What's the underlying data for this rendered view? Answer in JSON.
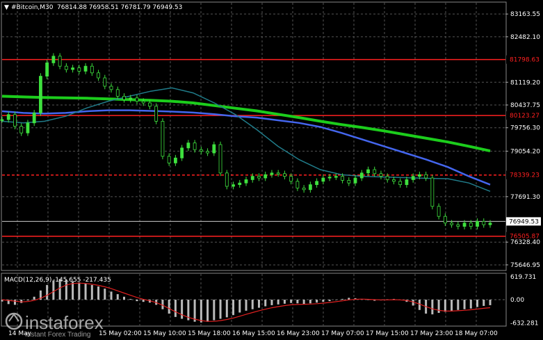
{
  "header": {
    "symbol": "#Bitcoin,M30",
    "ohlc": "76814.88 76958.51 76781.79 76949.53"
  },
  "chart_data": {
    "type": "candlestick",
    "price_axis": {
      "ticks": [
        {
          "label": "83163.55",
          "value": 83163.55
        },
        {
          "label": "82482.10",
          "value": 82482.1
        },
        {
          "label": "81119.20",
          "value": 81119.2
        },
        {
          "label": "80437.75",
          "value": 80437.75
        },
        {
          "label": "79756.30",
          "value": 79756.3
        },
        {
          "label": "79054.20",
          "value": 79054.2
        },
        {
          "label": "77691.30",
          "value": 77691.3
        },
        {
          "label": "76328.40",
          "value": 76328.4
        },
        {
          "label": "75646.95",
          "value": 75646.95
        }
      ],
      "ylim": [
        75500,
        83500
      ]
    },
    "current_price": {
      "label": "76949.53",
      "value": 76949.53
    },
    "levels": [
      {
        "label": "81798.63",
        "value": 81798.63,
        "color": "#ff2020",
        "style": "solid"
      },
      {
        "label": "80123.27",
        "value": 80123.27,
        "color": "#ff2020",
        "style": "solid"
      },
      {
        "label": "78339.23",
        "value": 78339.23,
        "color": "#ff2020",
        "style": "dashed"
      },
      {
        "label": "76505.87",
        "value": 76505.87,
        "color": "#ff2020",
        "style": "solid"
      }
    ],
    "time_axis": {
      "labels": [
        "14 May",
        "15 May 02:00",
        "15 May 10:00",
        "15 May 18:00",
        "16 May 15:00",
        "16 May 23:00",
        "17 May 07:00",
        "17 May 15:00",
        "17 May 23:00",
        "18 May 07:00"
      ]
    },
    "price_series": [
      80000,
      80150,
      79800,
      79600,
      79900,
      80200,
      81300,
      81700,
      81900,
      81600,
      81500,
      81550,
      81450,
      81600,
      81400,
      81250,
      81000,
      80900,
      80700,
      80600,
      80650,
      80550,
      80500,
      80400,
      79950,
      78900,
      78700,
      78850,
      79150,
      79300,
      79100,
      79050,
      79000,
      79250,
      78400,
      78000,
      78050,
      78100,
      78200,
      78300,
      78250,
      78350,
      78400,
      78380,
      78300,
      78150,
      77950,
      77900,
      78050,
      78150,
      78250,
      78280,
      78300,
      78180,
      78100,
      78250,
      78400,
      78500,
      78380,
      78300,
      78200,
      78150,
      78050,
      78200,
      78300,
      78350,
      78250,
      77400,
      77100,
      76900,
      76850,
      76800,
      76900,
      76800,
      76950,
      76850,
      76900
    ],
    "ma_series": [
      {
        "color": "#1ccd1c",
        "values": [
          80700,
          80680,
          80660,
          80650,
          80640,
          80620,
          80600,
          80580,
          80550,
          80500,
          80420,
          80340,
          80260,
          80160,
          80060,
          79950,
          79850,
          79760,
          79660,
          79550,
          79440,
          79330,
          79200,
          79060
        ]
      },
      {
        "color": "#4466ee",
        "values": [
          80250,
          80200,
          80180,
          80200,
          80250,
          80280,
          80280,
          80260,
          80240,
          80210,
          80160,
          80100,
          80060,
          79980,
          79900,
          79780,
          79600,
          79400,
          79200,
          79000,
          78800,
          78580,
          78300,
          78050
        ]
      },
      {
        "color": "#207c8a",
        "values": [
          79950,
          79900,
          79950,
          80100,
          80350,
          80550,
          80700,
          80850,
          80950,
          80800,
          80500,
          80150,
          79700,
          79200,
          78800,
          78500,
          78350,
          78300,
          78280,
          78260,
          78240,
          78230,
          78100,
          77850
        ]
      }
    ],
    "macd": {
      "label": "MACD(12,26,9)",
      "values_text": "-145.655 -217.435",
      "ticks": [
        {
          "label": "619.731",
          "value": 619.731
        },
        {
          "label": "0.00",
          "value": 0
        },
        {
          "label": "-632.281",
          "value": -632.281
        }
      ],
      "histogram": [
        -50,
        -120,
        -140,
        -90,
        -20,
        80,
        250,
        400,
        520,
        560,
        540,
        500,
        470,
        440,
        400,
        360,
        300,
        220,
        150,
        80,
        20,
        -40,
        -60,
        -80,
        -140,
        -260,
        -380,
        -470,
        -520,
        -560,
        -600,
        -620,
        -600,
        -560,
        -520,
        -480,
        -420,
        -350,
        -300,
        -260,
        -220,
        -180,
        -150,
        -130,
        -110,
        -90,
        -100,
        -120,
        -100,
        -80,
        -60,
        -40,
        -10,
        20,
        50,
        40,
        20,
        -10,
        -30,
        -20,
        10,
        20,
        -10,
        -60,
        -160,
        -280,
        -380,
        -400,
        -360,
        -330,
        -300,
        -280,
        -260,
        -240,
        -200,
        -170,
        -150
      ],
      "signal": [
        0,
        -20,
        -40,
        -60,
        -50,
        -20,
        40,
        120,
        220,
        320,
        400,
        440,
        450,
        440,
        420,
        390,
        350,
        300,
        240,
        180,
        120,
        60,
        10,
        -30,
        -80,
        -150,
        -240,
        -330,
        -410,
        -480,
        -530,
        -570,
        -590,
        -590,
        -570,
        -540,
        -500,
        -450,
        -400,
        -350,
        -300,
        -260,
        -220,
        -190,
        -160,
        -140,
        -130,
        -125,
        -120,
        -110,
        -95,
        -75,
        -55,
        -30,
        -5,
        10,
        15,
        10,
        0,
        -5,
        -5,
        0,
        -5,
        -20,
        -60,
        -120,
        -190,
        -250,
        -290,
        -310,
        -310,
        -300,
        -290,
        -275,
        -255,
        -235,
        -217
      ]
    }
  },
  "watermark": {
    "brand": "instaforex",
    "tagline": "Instant Forex Trading"
  }
}
